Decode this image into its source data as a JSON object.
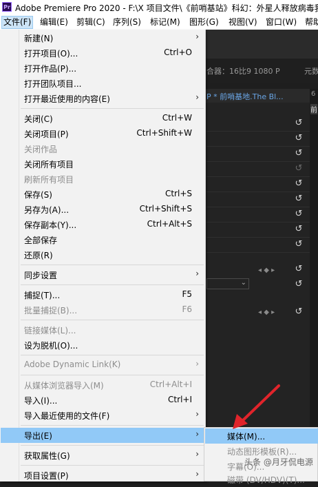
{
  "titlebar": {
    "icon_text": "Pr",
    "title": "Adobe Premiere Pro 2020 - F:\\X 项目文件\\《前哨基站》科幻：外星人释放病毒我"
  },
  "menubar": [
    "文件(F)",
    "编辑(E)",
    "剪辑(C)",
    "序列(S)",
    "标记(M)",
    "图形(G)",
    "视图(V)",
    "窗口(W)",
    "帮助"
  ],
  "background": {
    "container_info": "合器：16比9 1080 P",
    "meta_label": "元数",
    "sequence_tab": "P * 前哨基地.The Bl...",
    "right_tab": "前",
    "right_num": "6"
  },
  "file_menu": {
    "new": {
      "label": "新建(N)"
    },
    "open_project": {
      "label": "打开项目(O)...",
      "shortcut": "Ctrl+O"
    },
    "open_production": {
      "label": "打开作品(P)..."
    },
    "open_team_project": {
      "label": "打开团队项目..."
    },
    "open_recent": {
      "label": "打开最近使用的内容(E)"
    },
    "close": {
      "label": "关闭(C)",
      "shortcut": "Ctrl+W"
    },
    "close_project": {
      "label": "关闭项目(P)",
      "shortcut": "Ctrl+Shift+W"
    },
    "close_production": {
      "label": "关闭作品"
    },
    "close_all_projects": {
      "label": "关闭所有项目"
    },
    "refresh_all_projects": {
      "label": "刷新所有项目"
    },
    "save": {
      "label": "保存(S)",
      "shortcut": "Ctrl+S"
    },
    "save_as": {
      "label": "另存为(A)...",
      "shortcut": "Ctrl+Shift+S"
    },
    "save_copy": {
      "label": "保存副本(Y)...",
      "shortcut": "Ctrl+Alt+S"
    },
    "save_all": {
      "label": "全部保存"
    },
    "revert": {
      "label": "还原(R)"
    },
    "sync_settings": {
      "label": "同步设置"
    },
    "capture": {
      "label": "捕捉(T)...",
      "shortcut": "F5"
    },
    "batch_capture": {
      "label": "批量捕捉(B)...",
      "shortcut": "F6"
    },
    "link_media": {
      "label": "链接媒体(L)..."
    },
    "make_offline": {
      "label": "设为脱机(O)..."
    },
    "dynamic_link": {
      "label": "Adobe Dynamic Link(K)"
    },
    "import_from_browser": {
      "label": "从媒体浏览器导入(M)",
      "shortcut": "Ctrl+Alt+I"
    },
    "import": {
      "label": "导入(I)...",
      "shortcut": "Ctrl+I"
    },
    "import_recent": {
      "label": "导入最近使用的文件(F)"
    },
    "export": {
      "label": "导出(E)"
    },
    "get_properties": {
      "label": "获取属性(G)"
    },
    "project_settings": {
      "label": "项目设置(P)"
    }
  },
  "export_submenu": {
    "media": "媒体(M)...",
    "motion_graphics_template": "动态图形模板(R)...",
    "captions": "字幕(O)...",
    "tape": "磁带 (DV/HDV)(T)..."
  },
  "watermark": "头条 @月牙侃电源",
  "colors": {
    "highlight": "#91c9f7",
    "arrow": "#e0242b",
    "dark_background": "#232323"
  }
}
